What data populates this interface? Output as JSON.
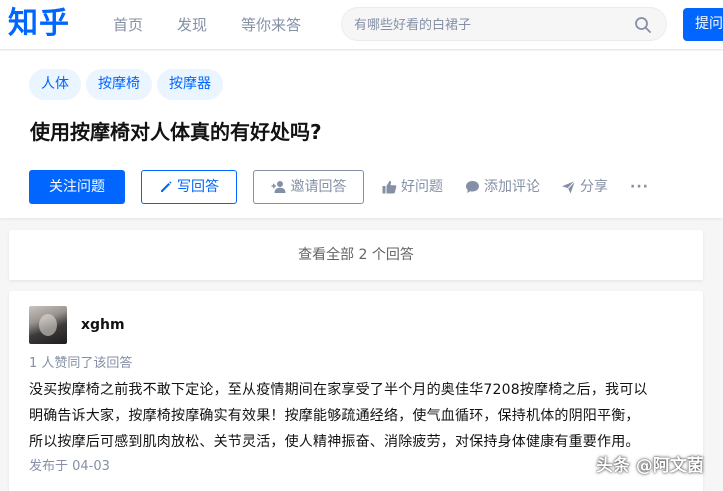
{
  "header": {
    "logo": "知乎",
    "nav": [
      "首页",
      "发现",
      "等你来答"
    ],
    "search_placeholder": "有哪些好看的白裙子",
    "ask_button": "提问"
  },
  "question": {
    "tags": [
      "人体",
      "按摩椅",
      "按摩器"
    ],
    "title": "使用按摩椅对人体真的有好处吗?",
    "actions": {
      "follow": "关注问题",
      "write": "写回答",
      "invite": "邀请回答",
      "good": "好问题",
      "comment": "添加评论",
      "share": "分享",
      "more": "···"
    }
  },
  "view_all": "查看全部 2 个回答",
  "answer": {
    "author": "xghm",
    "voters": "1 人赞同了该回答",
    "lines": [
      "没买按摩椅之前我不敢下定论，至从疫情期间在家享受了半个月的奥佳华7208按摩椅之后，我可以",
      "明确告诉大家，按摩椅按摩确实有效果！按摩能够疏通经络，使气血循环，保持机体的阴阳平衡，",
      "所以按摩后可感到肌肉放松、关节灵活，使人精神振奋、消除疲劳，对保持身体健康有重要作用。"
    ],
    "published": "发布于 04-03"
  },
  "watermark": "头条 @阿文菌",
  "colors": {
    "brand": "#0066ff",
    "muted": "#8590a6",
    "tag_bg": "#ebf5ff",
    "page_bg": "#f6f6f6"
  }
}
